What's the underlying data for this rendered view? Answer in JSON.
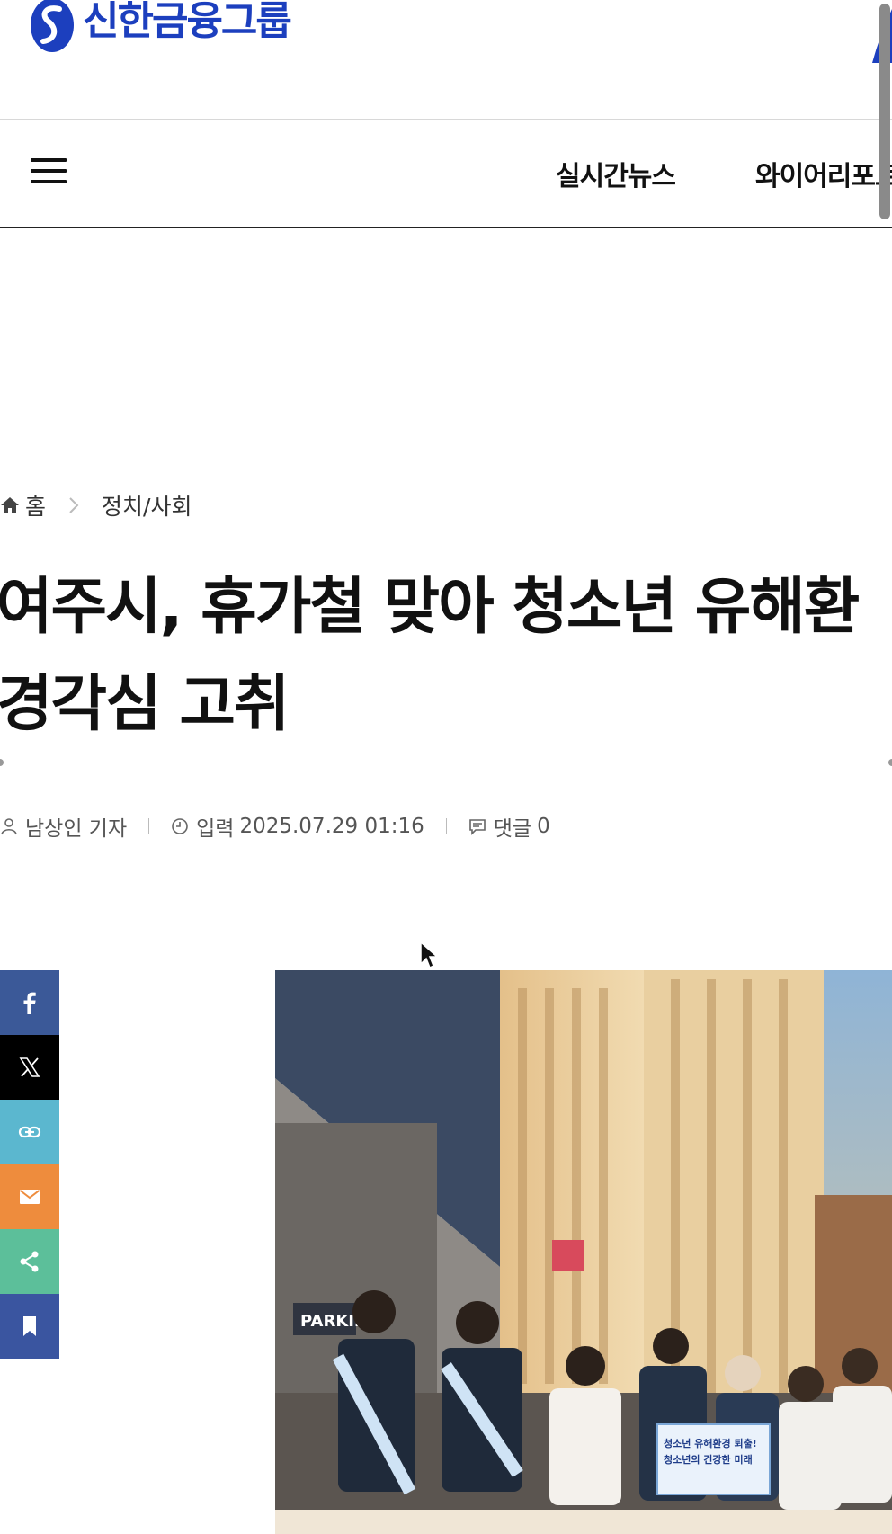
{
  "ad": {
    "brand_name": "신한금융그룹"
  },
  "nav": {
    "items": [
      "실시간뉴스",
      "와이어리포트"
    ]
  },
  "breadcrumb": {
    "home": "홈",
    "section": "정치/사회"
  },
  "article": {
    "headline_line1": "여주시, 휴가철 맞아 청소년 유해환",
    "headline_line2": "경각심 고취",
    "author": "남상인 기자",
    "published_label": "입력",
    "published_value": "2025.07.29 01:16",
    "comments_label": "댓글",
    "comments_count": "0"
  },
  "share": {
    "buttons": [
      "facebook-icon",
      "x-icon",
      "link-icon",
      "mail-icon",
      "share-icon",
      "bookmark-icon"
    ]
  },
  "photo": {
    "signs": {
      "parking": "PARKIN",
      "banner_line1": "청소년 유해환경 퇴출!",
      "banner_line2": "청소년의 건강한 미래"
    }
  },
  "colors": {
    "brand": "#1c3fbe",
    "facebook": "#3b5998",
    "x": "#000000",
    "link": "#5bb7cf",
    "mail": "#ee8c3d",
    "share": "#5cbf9a",
    "bookmark": "#3a55a0"
  }
}
